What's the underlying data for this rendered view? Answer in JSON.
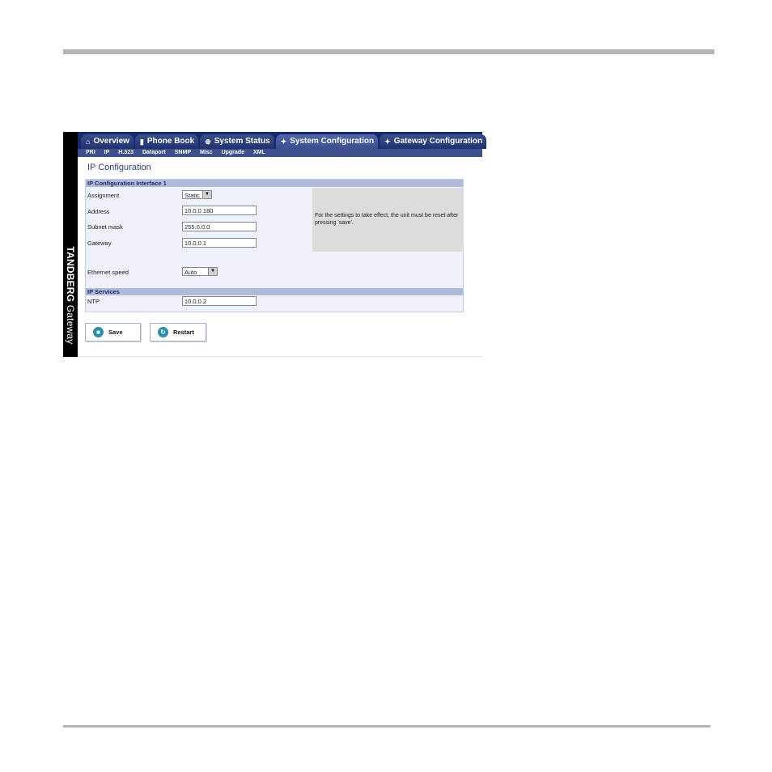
{
  "brand": {
    "name": "TANDBERG",
    "product": "Gateway"
  },
  "tabs": [
    {
      "label": "Overview",
      "icon": "home-icon",
      "active": false
    },
    {
      "label": "Phone Book",
      "icon": "book-icon",
      "active": false
    },
    {
      "label": "System Status",
      "icon": "status-icon",
      "active": false
    },
    {
      "label": "System Configuration",
      "icon": "wrench-icon",
      "active": true
    },
    {
      "label": "Gateway Configuration",
      "icon": "wrench-icon",
      "active": false
    }
  ],
  "subnav": [
    "PRI",
    "IP",
    "H.323",
    "Dataport",
    "SNMP",
    "Misc",
    "Upgrade",
    "XML"
  ],
  "page_title": "IP Configuration",
  "section1": {
    "title": "IP Configuration Interface 1",
    "assignment_label": "Assignment",
    "assignment_value": "Static",
    "address_label": "Address",
    "address_value": "10.0.0.180",
    "subnet_label": "Subnet mask",
    "subnet_value": "255.0.0.0",
    "gateway_label": "Gateway",
    "gateway_value": "10.0.0.1",
    "ethernet_label": "Ethernet speed",
    "ethernet_value": "Auto",
    "note": "For the settings to take effect, the unit must be reset after pressing 'save'."
  },
  "section2": {
    "title": "IP Services",
    "ntp_label": "NTP",
    "ntp_value": "10.0.0.2"
  },
  "buttons": {
    "save": "Save",
    "restart": "Restart"
  },
  "colors": {
    "nav_bg": "#152a6a",
    "section_header": "#b1badb",
    "panel_bg": "#eef1fa",
    "brand_bg": "#000000"
  }
}
